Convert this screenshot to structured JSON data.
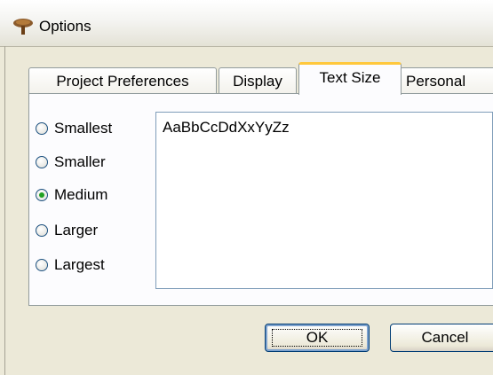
{
  "window": {
    "title": "Options",
    "icon": "tree-icon"
  },
  "tabs": [
    {
      "label": "Project Preferences",
      "active": false
    },
    {
      "label": "Display",
      "active": false
    },
    {
      "label": "Text Size",
      "active": true
    },
    {
      "label": "Personal",
      "active": false
    }
  ],
  "text_size": {
    "options": [
      {
        "label": "Smallest",
        "checked": false
      },
      {
        "label": "Smaller",
        "checked": false
      },
      {
        "label": "Medium",
        "checked": true
      },
      {
        "label": "Larger",
        "checked": false
      },
      {
        "label": "Largest",
        "checked": false
      }
    ],
    "preview_text": "AaBbCcDdXxYyZz"
  },
  "buttons": {
    "ok": "OK",
    "cancel": "Cancel"
  }
}
